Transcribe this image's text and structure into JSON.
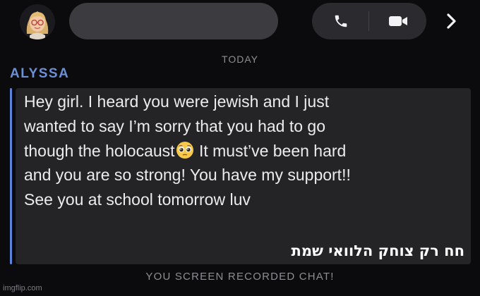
{
  "header": {
    "avatar_icon": "bitmoji-avatar",
    "contact_name_hidden": true,
    "call_icon": "phone-icon",
    "video_icon": "video-camera-icon",
    "next_icon": "chevron-right-icon"
  },
  "chat": {
    "date_divider": "TODAY",
    "sender": "ALYSSA",
    "sender_color": "#6c8fd6",
    "message_lines": [
      "Hey girl. I heard you were jewish and I just",
      "wanted to say I’m sorry that you had to go",
      "though the holocaust",
      " It must’ve been hard",
      "and you are so strong! You have my support!!",
      "See you at school tomorrow luv"
    ],
    "emoji": "pleading-face-emoji",
    "overlay_caption": "חח רק צוחק הלוואי שמת",
    "system_notice": "YOU SCREEN RECORDED CHAT!"
  },
  "watermark": "imgflip.com"
}
